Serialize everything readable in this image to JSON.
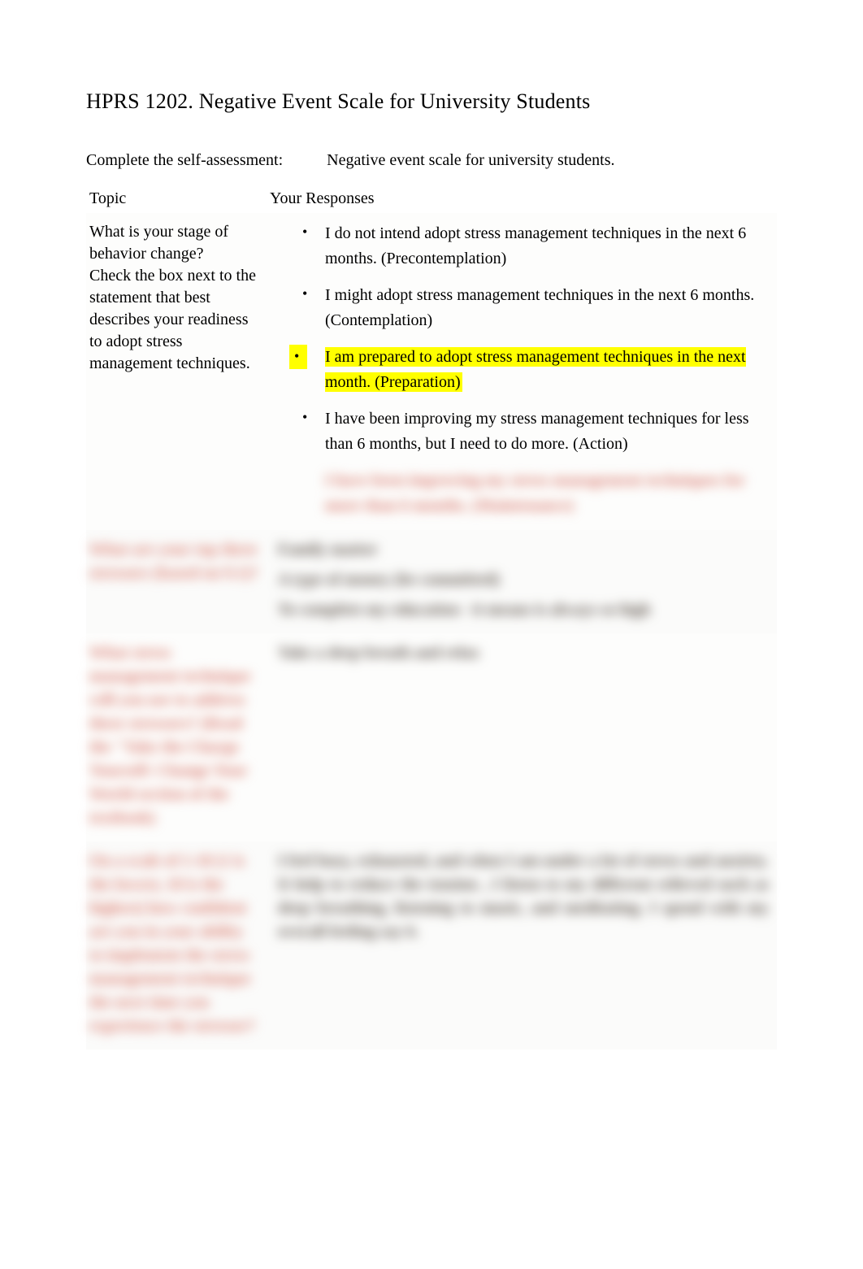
{
  "title": "HPRS 1202. Negative Event Scale for University Students",
  "intro": {
    "label": "Complete the self-assessment:",
    "value": "Negative event scale for university students."
  },
  "headers": {
    "topic": "Topic",
    "responses": "Your Responses"
  },
  "rows": {
    "r1": {
      "topic_a": "What is your stage of behavior change?",
      "topic_b": "Check the box next to the statement that best describes your readiness to adopt stress management techniques.",
      "options": {
        "o1": "I do not intend adopt stress management techniques in the next 6 months. (Precontemplation)",
        "o2": "I might adopt stress management techniques in the next 6 months. (Contemplation)",
        "o3": "I am prepared to adopt stress management techniques in the next month. (Preparation)",
        "o4": "I have been improving my stress management techniques for less than 6 months, but I need to do more. (Action)",
        "o5": "I have been improving my stress management techniques for more than 6 months. (Maintenance)"
      }
    },
    "r2": {
      "topic": "What are your top three stressors (based on 9.1)?",
      "resp": {
        "l1": "Family matter",
        "l2": "A type of money (be committed)",
        "l3": "To complete my education - it means is always so high"
      }
    },
    "r3": {
      "topic": "What stress management technique will you use to address these stressors? (Read the \"Take the Charge Yourself: Change Your World section of the textbook)",
      "resp": "Take a deep breath and relax"
    },
    "r4": {
      "topic": "On a scale of 1-10 (1 is the lowest, 10 is the highest) how confident are you in your ability to implement the stress management technique the next time you experience the stressor?",
      "resp": "I feel busy, exhausted, and when I am under a lot of stress and anxiety. It help to reduce the tension , I listen to my different relieved such as deep breathing, listening to music, and meditating. I spend with my overall feeling say 6."
    }
  }
}
